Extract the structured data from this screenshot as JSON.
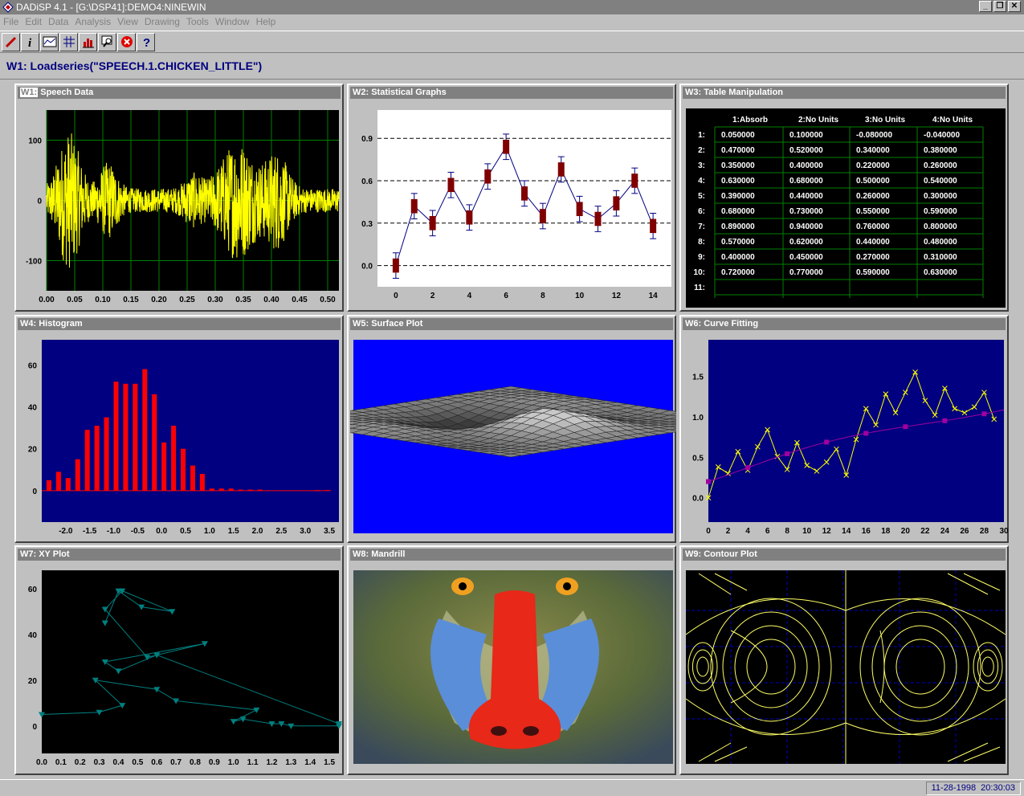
{
  "app": {
    "title": "DADiSP 4.1 - [G:\\DSP41]:DEMO4:NINEWIN"
  },
  "menu": [
    "File",
    "Edit",
    "Data",
    "Analysis",
    "View",
    "Drawing",
    "Tools",
    "Window",
    "Help"
  ],
  "toolbar": [
    "pencil-icon",
    "info-icon",
    "graph-icon",
    "grid-icon",
    "bar-chart-icon",
    "zoom-icon",
    "stop-icon",
    "help-icon"
  ],
  "command": "W1: Loadseries(\"SPEECH.1.CHICKEN_LITTLE\")",
  "windows": {
    "w1": {
      "label": "W1:",
      "title": "Speech Data"
    },
    "w2": {
      "title": "W2: Statistical Graphs"
    },
    "w3": {
      "title": "W3: Table Manipulation"
    },
    "w4": {
      "title": "W4: Histogram"
    },
    "w5": {
      "title": "W5: Surface Plot"
    },
    "w6": {
      "title": "W6: Curve Fitting"
    },
    "w7": {
      "title": "W7: XY Plot"
    },
    "w8": {
      "title": "W8: Mandrill"
    },
    "w9": {
      "title": "W9: Contour Plot"
    }
  },
  "table": {
    "headers": [
      "1:Absorb",
      "2:No Units",
      "3:No Units",
      "4:No Units"
    ],
    "rows": [
      {
        "n": "1:",
        "v": [
          "0.050000",
          "0.100000",
          "-0.080000",
          "-0.040000"
        ]
      },
      {
        "n": "2:",
        "v": [
          "0.470000",
          "0.520000",
          "0.340000",
          "0.380000"
        ]
      },
      {
        "n": "3:",
        "v": [
          "0.350000",
          "0.400000",
          "0.220000",
          "0.260000"
        ]
      },
      {
        "n": "4:",
        "v": [
          "0.630000",
          "0.680000",
          "0.500000",
          "0.540000"
        ]
      },
      {
        "n": "5:",
        "v": [
          "0.390000",
          "0.440000",
          "0.260000",
          "0.300000"
        ]
      },
      {
        "n": "6:",
        "v": [
          "0.680000",
          "0.730000",
          "0.550000",
          "0.590000"
        ]
      },
      {
        "n": "7:",
        "v": [
          "0.890000",
          "0.940000",
          "0.760000",
          "0.800000"
        ]
      },
      {
        "n": "8:",
        "v": [
          "0.570000",
          "0.620000",
          "0.440000",
          "0.480000"
        ]
      },
      {
        "n": "9:",
        "v": [
          "0.400000",
          "0.450000",
          "0.270000",
          "0.310000"
        ]
      },
      {
        "n": "10:",
        "v": [
          "0.720000",
          "0.770000",
          "0.590000",
          "0.630000"
        ]
      },
      {
        "n": "11:",
        "v": [
          "",
          "",
          "",
          ""
        ]
      }
    ]
  },
  "colors": {
    "navy": "#000080",
    "speech": "#ffff00",
    "hist": "#ff0000",
    "box": "#800000",
    "xy": "#008080",
    "contour": "#ffff66",
    "surface_bg": "#0000ff"
  },
  "chart_data": [
    {
      "id": "w1",
      "type": "line",
      "xlim": [
        0,
        0.52
      ],
      "ylim": [
        -150,
        150
      ],
      "xticks": [
        "0.00",
        "0.05",
        "0.10",
        "0.15",
        "0.20",
        "0.25",
        "0.30",
        "0.35",
        "0.40",
        "0.45",
        "0.50"
      ],
      "yticks": [
        "100",
        "0",
        "-100"
      ]
    },
    {
      "id": "w2",
      "type": "line",
      "xlim": [
        -1,
        15
      ],
      "ylim": [
        -0.15,
        1.1
      ],
      "xticks": [
        "0",
        "2",
        "4",
        "6",
        "8",
        "10",
        "12",
        "14"
      ],
      "yticks": [
        "0.9",
        "0.6",
        "0.3",
        "0.0"
      ],
      "values": [
        0.0,
        0.42,
        0.3,
        0.57,
        0.34,
        0.63,
        0.84,
        0.51,
        0.35,
        0.68,
        0.4,
        0.33,
        0.44,
        0.6,
        0.28
      ]
    },
    {
      "id": "w4",
      "type": "bar",
      "xlim": [
        -2.5,
        3.7
      ],
      "ylim": [
        -15,
        72
      ],
      "xticks": [
        "-2.0",
        "-1.5",
        "-1.0",
        "-0.5",
        "0.0",
        "0.5",
        "1.0",
        "1.5",
        "2.0",
        "2.5",
        "3.0",
        "3.5"
      ],
      "yticks": [
        "60",
        "40",
        "20",
        "0"
      ],
      "x": [
        -2.35,
        -2.15,
        -1.95,
        -1.75,
        -1.55,
        -1.35,
        -1.15,
        -0.95,
        -0.75,
        -0.55,
        -0.35,
        -0.15,
        0.05,
        0.25,
        0.45,
        0.65,
        0.85,
        1.05,
        1.25,
        1.45,
        1.65,
        1.85,
        2.05,
        2.25,
        2.45,
        2.65,
        2.85,
        3.05,
        3.25,
        3.45
      ],
      "values": [
        5,
        9,
        6,
        15,
        29,
        31,
        35,
        52,
        51,
        51,
        58,
        46,
        23,
        31,
        20,
        12,
        8,
        1,
        1,
        1,
        0.5,
        0.5,
        0.5,
        0,
        0,
        0,
        0,
        0,
        0.3,
        0.3
      ]
    },
    {
      "id": "w6",
      "type": "line",
      "xlim": [
        0,
        30
      ],
      "ylim": [
        -0.3,
        1.95
      ],
      "xticks": [
        "0",
        "2",
        "4",
        "6",
        "8",
        "10",
        "12",
        "14",
        "16",
        "18",
        "20",
        "22",
        "24",
        "26",
        "28",
        "30"
      ],
      "yticks": [
        "1.5",
        "1.0",
        "0.5",
        "0.0"
      ],
      "values": [
        0.0,
        0.38,
        0.3,
        0.57,
        0.34,
        0.63,
        0.84,
        0.51,
        0.35,
        0.68,
        0.4,
        0.33,
        0.44,
        0.6,
        0.28,
        0.72,
        1.1,
        0.9,
        1.28,
        1.05,
        1.3,
        1.55,
        1.2,
        1.02,
        1.35,
        1.1,
        1.05,
        1.12,
        1.3,
        0.97
      ]
    },
    {
      "id": "w7",
      "type": "scatter",
      "xlim": [
        0,
        1.55
      ],
      "ylim": [
        -12,
        68
      ],
      "xticks": [
        "0.0",
        "0.1",
        "0.2",
        "0.3",
        "0.4",
        "0.5",
        "0.6",
        "0.7",
        "0.8",
        "0.9",
        "1.0",
        "1.1",
        "1.2",
        "1.3",
        "1.4",
        "1.5"
      ],
      "yticks": [
        "60",
        "40",
        "20",
        "0"
      ],
      "x": [
        0.0,
        0.3,
        0.42,
        0.28,
        0.6,
        0.7,
        1.12,
        1.0,
        1.05,
        1.2,
        1.25,
        1.3,
        1.55,
        1.55,
        0.6,
        0.4,
        0.33,
        0.85,
        0.55,
        0.33,
        0.42,
        0.68,
        0.52,
        0.4,
        0.33
      ],
      "y": [
        5,
        6,
        9,
        20,
        16,
        11,
        7,
        2,
        3,
        1,
        1,
        0,
        0,
        1,
        31,
        24,
        28,
        36,
        30,
        51,
        59,
        50,
        52,
        59,
        45
      ]
    }
  ]
}
